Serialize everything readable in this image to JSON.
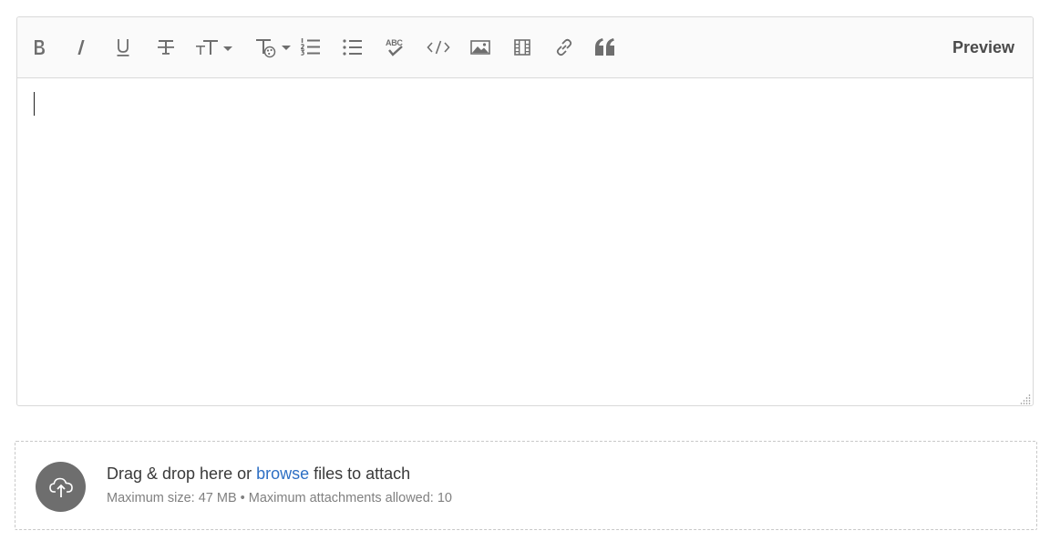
{
  "toolbar": {
    "buttons": [
      {
        "icon": "bold-icon"
      },
      {
        "icon": "italic-icon"
      },
      {
        "icon": "underline-icon"
      },
      {
        "icon": "strikethrough-icon"
      },
      {
        "icon": "font-size-icon"
      },
      {
        "icon": "font-color-icon"
      },
      {
        "icon": "numbered-list-icon"
      },
      {
        "icon": "bulleted-list-icon"
      },
      {
        "icon": "spellcheck-icon"
      },
      {
        "icon": "code-icon"
      },
      {
        "icon": "image-icon"
      },
      {
        "icon": "video-icon"
      },
      {
        "icon": "link-icon"
      },
      {
        "icon": "quote-icon"
      }
    ],
    "spellcheck_glyph": "ABC",
    "preview_label": "Preview"
  },
  "editor": {
    "content": ""
  },
  "dropzone": {
    "text_before": "Drag & drop here or ",
    "browse_label": "browse",
    "text_after": " files to attach",
    "limits": "Maximum size: 47 MB • Maximum attachments allowed: 10"
  },
  "colors": {
    "icon": "#6e6e6e",
    "link": "#2d6fc4",
    "border": "#d9d9d9",
    "toolbar_bg": "#fafafa",
    "upload_circle": "#6e6e6e"
  }
}
